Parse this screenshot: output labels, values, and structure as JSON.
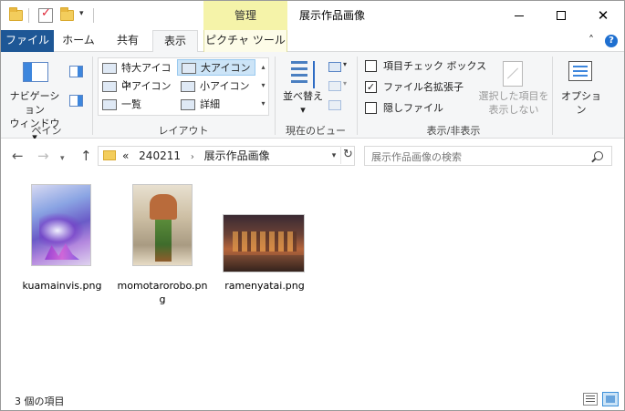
{
  "window": {
    "title": "展示作品画像",
    "context_tab": "管理",
    "colors": {
      "file_tab": "#1e5796",
      "context_tab": "#f5f3a9",
      "selection": "#cce4f7"
    }
  },
  "quick_access": {
    "dropdown_glyph": "▾"
  },
  "window_controls": {
    "close_glyph": "✕"
  },
  "tabs": {
    "file": "ファイル",
    "home": "ホーム",
    "share": "共有",
    "view": "表示",
    "picture_tools": "ピクチャ ツール",
    "collapse_glyph": "˄",
    "help_glyph": "?"
  },
  "ribbon": {
    "pane": {
      "nav_pane_line1": "ナビゲーション",
      "nav_pane_line2": "ウィンドウ ▾",
      "group_label": "ペイン"
    },
    "layout": {
      "items": [
        "特大アイコン",
        "大アイコン",
        "中アイコン",
        "小アイコン",
        "一覧",
        "詳細"
      ],
      "selected": "大アイコン",
      "group_label": "レイアウト",
      "scroll_up": "▴",
      "scroll_down": "▾",
      "scroll_more": "▾"
    },
    "current_view": {
      "sort_line1": "並べ替え",
      "sort_arrow": "▾",
      "group_label": "現在のビュー",
      "small_arrow": "▾"
    },
    "show_hide": {
      "item_checkboxes": "項目チェック ボックス",
      "file_extensions": "ファイル名拡張子",
      "hidden_items": "隠しファイル",
      "item_checkboxes_checked": false,
      "file_extensions_checked": true,
      "hidden_items_checked": false,
      "check_glyph": "✓",
      "hide_selected_line1": "選択した項目を",
      "hide_selected_line2": "表示しない",
      "group_label": "表示/非表示"
    },
    "options": {
      "label": "オプション"
    }
  },
  "navigation": {
    "back_glyph": "←",
    "forward_glyph": "→",
    "recent_glyph": "▾",
    "up_glyph": "↑",
    "address": {
      "overflow": "«",
      "crumbs": [
        "240211",
        "展示作品画像"
      ],
      "separator": "›",
      "dropdown_glyph": "▾",
      "refresh_glyph": "↻"
    },
    "search_placeholder": "展示作品画像の検索"
  },
  "files": [
    {
      "name": "kuamainvis.png"
    },
    {
      "name": "momotarorobo.png"
    },
    {
      "name": "ramenyatai.png"
    }
  ],
  "status": {
    "item_count": "3 個の項目"
  }
}
